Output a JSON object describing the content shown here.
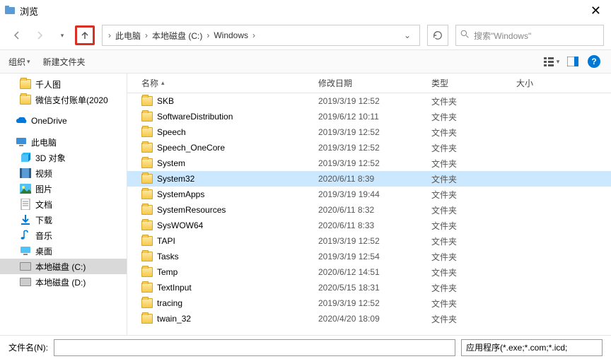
{
  "window": {
    "title": "浏览",
    "close": "✕"
  },
  "nav": {
    "breadcrumb": [
      "此电脑",
      "本地磁盘 (C:)",
      "Windows"
    ],
    "search_placeholder": "搜索\"Windows\""
  },
  "toolbar": {
    "organize": "组织",
    "newfolder": "新建文件夹"
  },
  "sidebar": {
    "quick": [
      {
        "name": "千人图",
        "icon": "folder"
      },
      {
        "name": "微信支付账单(2020",
        "icon": "folder"
      }
    ],
    "onedrive": "OneDrive",
    "thispc": "此电脑",
    "pcitems": [
      {
        "name": "3D 对象",
        "icon": "3d"
      },
      {
        "name": "视频",
        "icon": "video"
      },
      {
        "name": "图片",
        "icon": "pictures"
      },
      {
        "name": "文档",
        "icon": "docs"
      },
      {
        "name": "下载",
        "icon": "download"
      },
      {
        "name": "音乐",
        "icon": "music"
      },
      {
        "name": "桌面",
        "icon": "desktop"
      },
      {
        "name": "本地磁盘 (C:)",
        "icon": "disk",
        "selected": true
      },
      {
        "name": "本地磁盘 (D:)",
        "icon": "disk"
      }
    ]
  },
  "columns": {
    "name": "名称",
    "date": "修改日期",
    "type": "类型",
    "size": "大小"
  },
  "files": [
    {
      "name": "SKB",
      "date": "2019/3/19 12:52",
      "type": "文件夹"
    },
    {
      "name": "SoftwareDistribution",
      "date": "2019/6/12 10:11",
      "type": "文件夹"
    },
    {
      "name": "Speech",
      "date": "2019/3/19 12:52",
      "type": "文件夹"
    },
    {
      "name": "Speech_OneCore",
      "date": "2019/3/19 12:52",
      "type": "文件夹"
    },
    {
      "name": "System",
      "date": "2019/3/19 12:52",
      "type": "文件夹"
    },
    {
      "name": "System32",
      "date": "2020/6/11 8:39",
      "type": "文件夹",
      "selected": true
    },
    {
      "name": "SystemApps",
      "date": "2019/3/19 19:44",
      "type": "文件夹"
    },
    {
      "name": "SystemResources",
      "date": "2020/6/11 8:32",
      "type": "文件夹"
    },
    {
      "name": "SysWOW64",
      "date": "2020/6/11 8:33",
      "type": "文件夹"
    },
    {
      "name": "TAPI",
      "date": "2019/3/19 12:52",
      "type": "文件夹"
    },
    {
      "name": "Tasks",
      "date": "2019/3/19 12:54",
      "type": "文件夹"
    },
    {
      "name": "Temp",
      "date": "2020/6/12 14:51",
      "type": "文件夹"
    },
    {
      "name": "TextInput",
      "date": "2020/5/15 18:31",
      "type": "文件夹"
    },
    {
      "name": "tracing",
      "date": "2019/3/19 12:52",
      "type": "文件夹"
    },
    {
      "name": "twain_32",
      "date": "2020/4/20 18:09",
      "type": "文件夹"
    }
  ],
  "bottom": {
    "filename_label": "文件名(N):",
    "filter": "应用程序(*.exe;*.com;*.icd;"
  }
}
